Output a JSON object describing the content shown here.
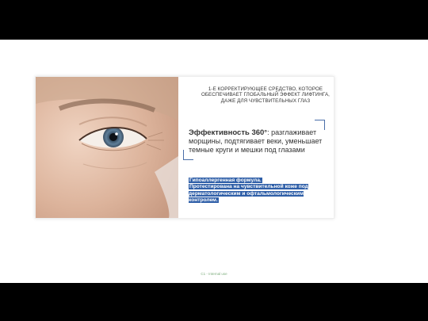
{
  "slide": {
    "headline": "1-е корректирующее средство, которое обеспечивает глобальный эффект лифтинга, даже для чувствительных глаз",
    "benefit_strong": "Эффективность 360°",
    "benefit_rest": ": разглаживает морщины, подтягивает веки, уменьшает темные круги и мешки под глазами",
    "formula_line1": "Гипоаллергенная формула.",
    "formula_line2": "Протестирована на чувствительной коже под дерматологическим и офтальмологическим контролем.",
    "footer": "C1 - Internal use"
  },
  "colors": {
    "accent": "#2f5fa8",
    "bracket": "#4a6ea8",
    "background": "#ffffff",
    "letterbox": "#000000"
  }
}
